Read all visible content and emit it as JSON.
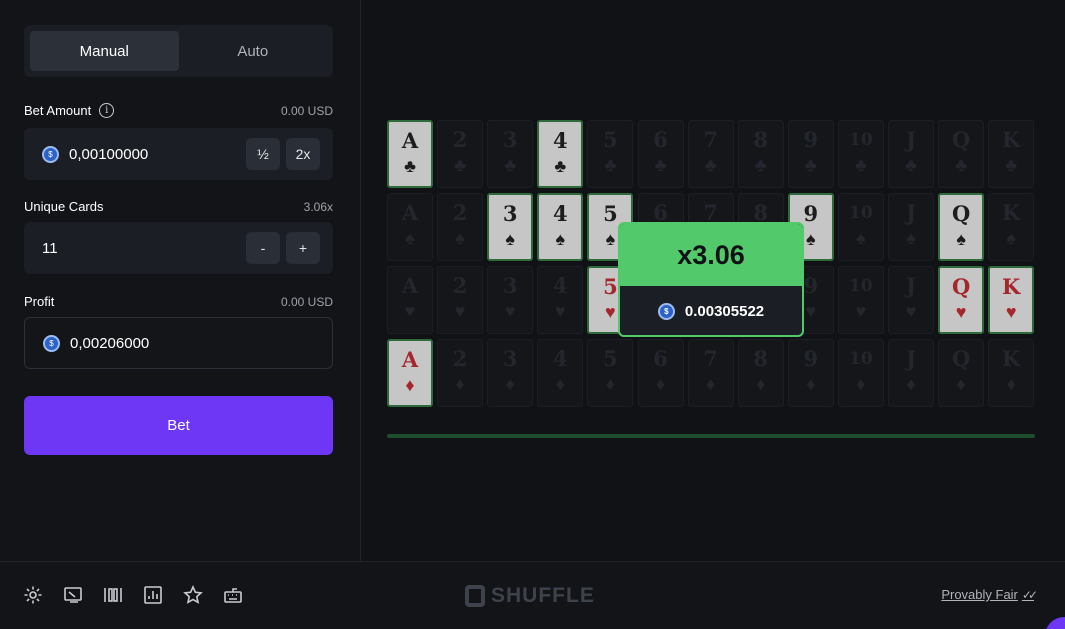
{
  "modes": {
    "manual": "Manual",
    "auto": "Auto"
  },
  "bet_amount": {
    "label": "Bet Amount",
    "usd": "0.00 USD",
    "value": "0,00100000",
    "half": "½",
    "double": "2x"
  },
  "unique_cards": {
    "label": "Unique Cards",
    "multiplier": "3.06x",
    "value": "11",
    "minus": "-",
    "plus": "+"
  },
  "profit": {
    "label": "Profit",
    "usd": "0.00 USD",
    "value": "0,00206000"
  },
  "bet_button": "Bet",
  "popup": {
    "multiplier": "x3.06",
    "payout": "0.00305522"
  },
  "cards": {
    "ranks": [
      "A",
      "2",
      "3",
      "4",
      "5",
      "6",
      "7",
      "8",
      "9",
      "10",
      "J",
      "Q",
      "K"
    ],
    "rows": [
      {
        "suit": "♣",
        "color": "black",
        "revealed": [
          "A",
          "4"
        ]
      },
      {
        "suit": "♠",
        "color": "black",
        "revealed": [
          "3",
          "4",
          "5",
          "9",
          "Q"
        ]
      },
      {
        "suit": "♥",
        "color": "red",
        "revealed": [
          "5",
          "Q",
          "K"
        ]
      },
      {
        "suit": "♦",
        "color": "red",
        "revealed": [
          "A"
        ]
      }
    ]
  },
  "footer": {
    "logo": "SHUFFLE",
    "provably_fair": "Provably Fair",
    "icons": [
      "settings-icon",
      "theatre-mode-icon",
      "live-stats-icon",
      "stats-chart-icon",
      "favorite-star-icon",
      "keyboard-icon"
    ]
  },
  "colors": {
    "accent": "#6e37f5",
    "win": "#52c96a"
  }
}
